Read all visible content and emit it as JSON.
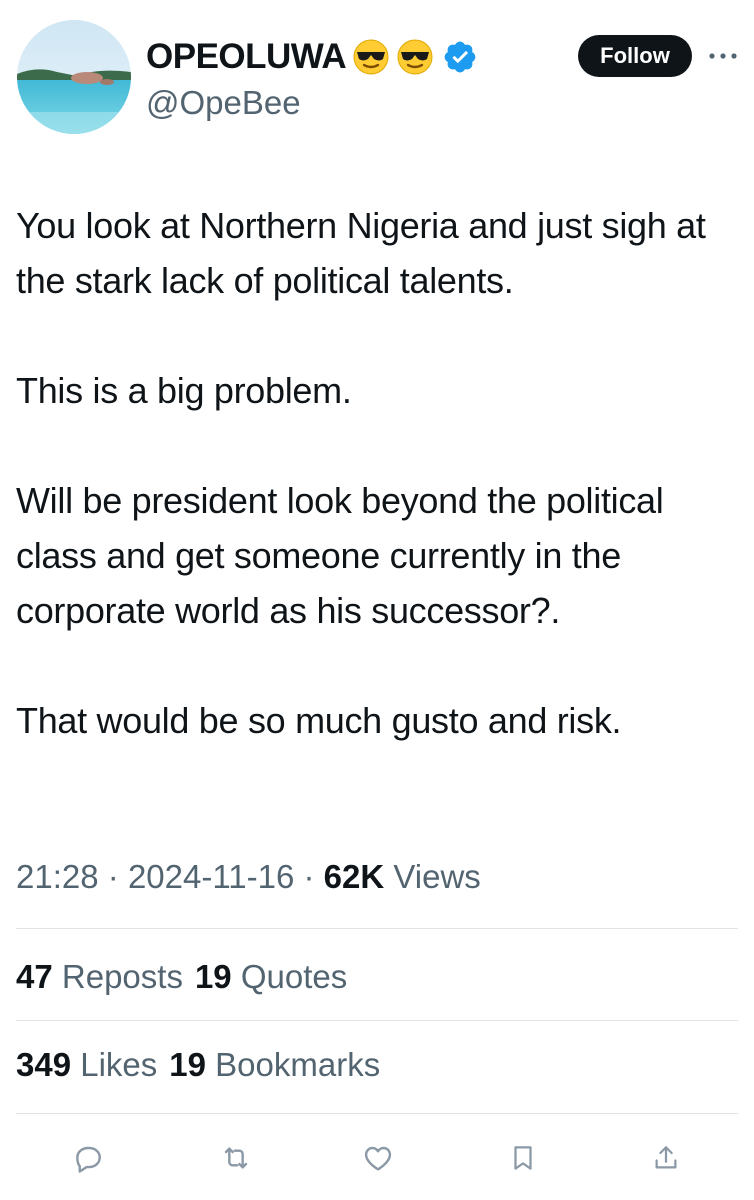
{
  "author": {
    "display_name": "OPEOLUWA",
    "emojis": [
      "sunglasses-face-emoji",
      "sunglasses-face-emoji"
    ],
    "verified": true,
    "handle": "@OpeBee",
    "avatar_icon": "beach-avatar"
  },
  "header": {
    "follow_label": "Follow",
    "more_icon": "more-horizontal-icon"
  },
  "tweet": {
    "paragraphs": [
      "You look at Northern Nigeria and just sigh at the stark lack of political talents.",
      "This is a big problem.",
      "Will be president look beyond the political class and get someone currently in the corporate world as his successor?.",
      "That would be so much gusto and risk."
    ]
  },
  "meta": {
    "time": "21:28",
    "separator": "·",
    "date": "2024-11-16",
    "views_count": "62K",
    "views_label": "Views"
  },
  "stats": {
    "reposts_count": "47",
    "reposts_label": "Reposts",
    "quotes_count": "19",
    "quotes_label": "Quotes",
    "likes_count": "349",
    "likes_label": "Likes",
    "bookmarks_count": "19",
    "bookmarks_label": "Bookmarks"
  },
  "actions": [
    "reply-icon",
    "repost-icon",
    "like-icon",
    "bookmark-icon",
    "share-icon"
  ],
  "colors": {
    "text": "#0f1419",
    "secondary": "#536471",
    "verified": "#1d9bf0",
    "divider": "#dfe3e6",
    "follow_bg": "#0f1419"
  }
}
